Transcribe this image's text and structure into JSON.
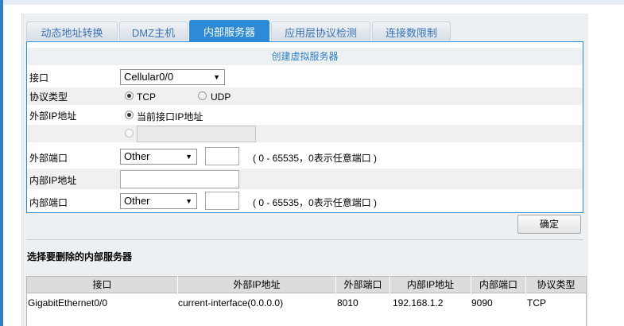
{
  "tabs": [
    "动态地址转换",
    "DMZ主机",
    "内部服务器",
    "应用层协议检测",
    "连接数限制"
  ],
  "form": {
    "title": "创建虚拟服务器",
    "interface_label": "接口",
    "interface_value": "Cellular0/0",
    "protocol_label": "协议类型",
    "protocol_tcp": "TCP",
    "protocol_udp": "UDP",
    "protocol_selected": "TCP",
    "ext_ip_label": "外部IP地址",
    "ext_ip_option_current": "当前接口IP地址",
    "ext_ip_custom_value": "",
    "ext_port_label": "外部端口",
    "ext_port_select": "Other",
    "ext_port_value": "",
    "port_hint": "( 0 - 65535，0表示任意端口 )",
    "int_ip_label": "内部IP地址",
    "int_ip_value": "",
    "int_port_label": "内部端口",
    "int_port_select": "Other",
    "int_port_value": "",
    "confirm": "确定"
  },
  "list": {
    "title": "选择要删除的内部服务器",
    "columns": [
      "接口",
      "外部IP地址",
      "外部端口",
      "内部IP地址",
      "内部端口",
      "协议类型"
    ],
    "rows": [
      [
        "GigabitEthernet0/0",
        "current-interface(0.0.0.0)",
        "8010",
        "192.168.1.2",
        "9090",
        "TCP"
      ]
    ]
  }
}
